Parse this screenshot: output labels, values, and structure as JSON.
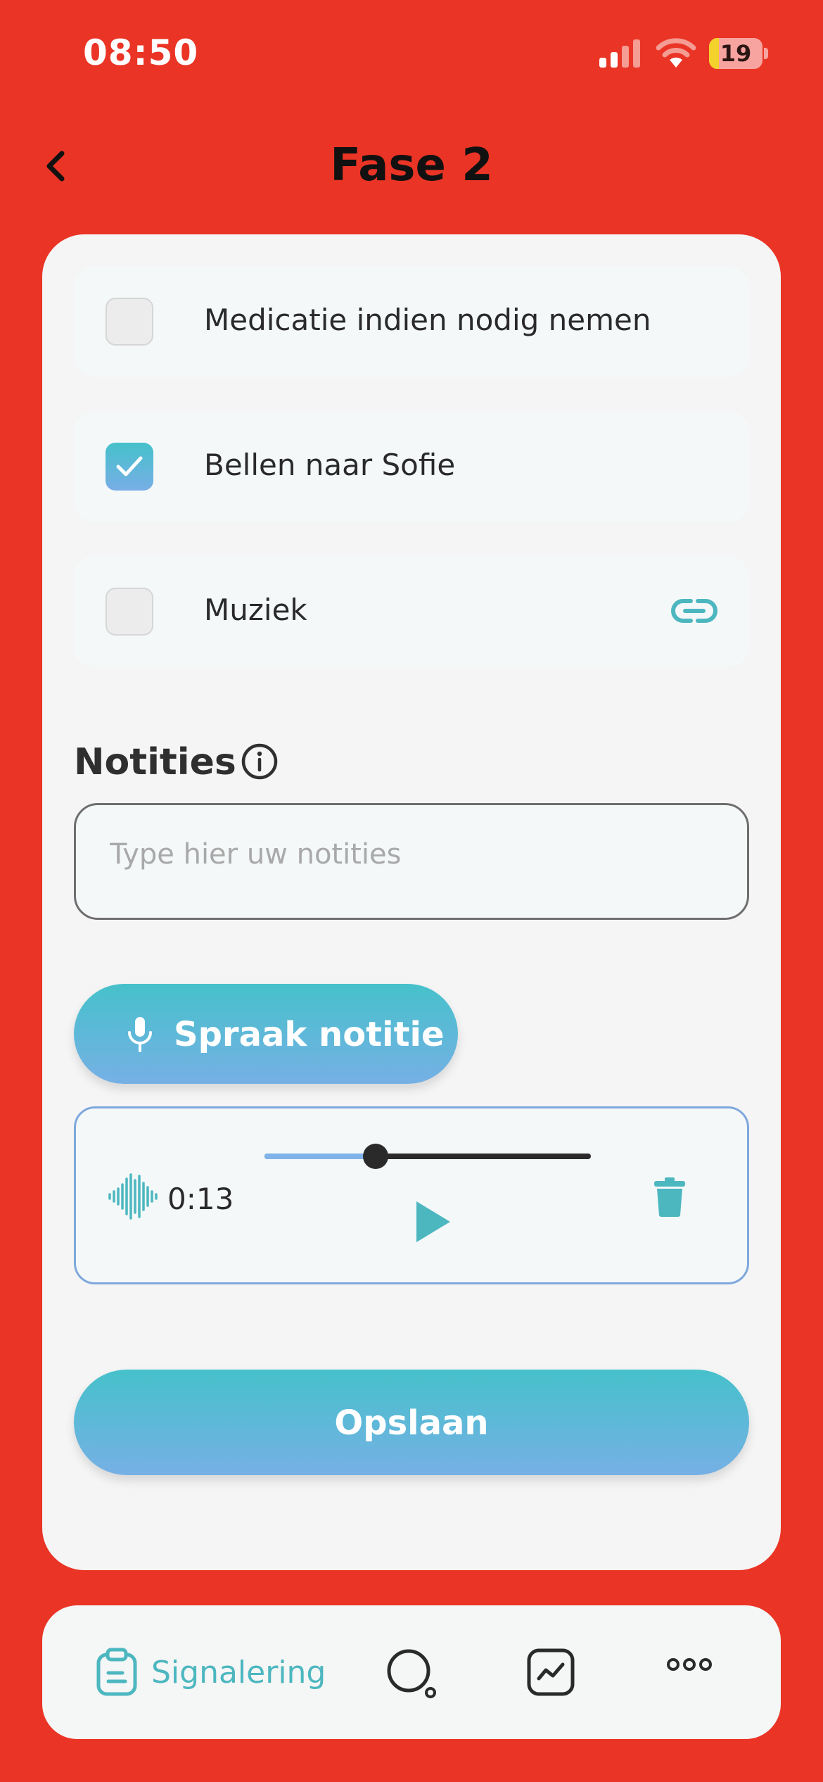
{
  "status_bar": {
    "time": "08:50",
    "battery": "19"
  },
  "header": {
    "title": "Fase 2"
  },
  "tasks": [
    {
      "label": "Medicatie indien nodig nemen",
      "checked": false
    },
    {
      "label": "Bellen naar Sofie",
      "checked": true
    },
    {
      "label": "Muziek",
      "checked": false,
      "has_link": true
    }
  ],
  "notes": {
    "title": "Notities",
    "placeholder": "Type hier uw notities",
    "value": ""
  },
  "voice_note": {
    "button_label": "Spraak notitie",
    "duration": "0:13",
    "progress": 0.34
  },
  "save": {
    "label": "Opslaan"
  },
  "tabbar": {
    "active_label": "Signalering",
    "icons": [
      "clipboard-icon",
      "search-icon",
      "chart-icon",
      "more-icon"
    ]
  },
  "colors": {
    "background": "#EA3425",
    "accent_start": "#46C1CB",
    "accent_end": "#76B0E5",
    "accent_text": "#4DB7C0"
  }
}
